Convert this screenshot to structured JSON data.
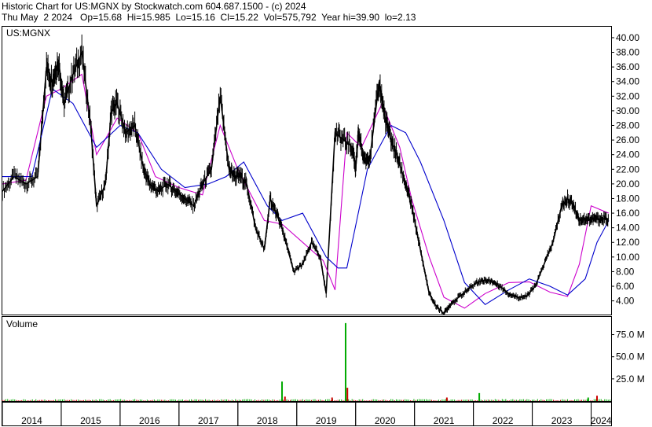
{
  "header": {
    "line1": "Historic Chart for US:MGNX by Stockwatch.com 604.687.1500 - (c) 2024",
    "line2": "Thu May  2 2024   Op=15.68  Hi=15.985  Lo=15.16  Cl=15.22  Vol=575,792  Year hi=39.90  lo=2.13"
  },
  "chart_data": {
    "type": "line",
    "title": "US:MGNX",
    "price_panel": {
      "ylim": [
        2.13,
        41.5
      ],
      "y_ticks": [
        "4.00",
        "6.00",
        "8.00",
        "10.00",
        "12.00",
        "14.00",
        "16.00",
        "18.00",
        "20.00",
        "22.00",
        "24.00",
        "26.00",
        "28.00",
        "30.00",
        "32.00",
        "34.00",
        "36.00",
        "38.00",
        "40.00"
      ],
      "series": [
        {
          "key": "price",
          "color": "#000000",
          "x": [
            2014.0,
            2014.2,
            2014.4,
            2014.6,
            2014.75,
            2014.85,
            2014.95,
            2015.05,
            2015.2,
            2015.35,
            2015.5,
            2015.6,
            2015.75,
            2015.85,
            2015.95,
            2016.1,
            2016.25,
            2016.4,
            2016.5,
            2016.65,
            2016.8,
            2016.95,
            2017.1,
            2017.25,
            2017.4,
            2017.55,
            2017.7,
            2017.85,
            2017.95,
            2018.05,
            2018.15,
            2018.3,
            2018.45,
            2018.55,
            2018.65,
            2018.75,
            2018.85,
            2018.95,
            2019.1,
            2019.25,
            2019.4,
            2019.5,
            2019.65,
            2019.8,
            2019.95,
            2020.0,
            2020.05,
            2020.15,
            2020.25,
            2020.4,
            2020.5,
            2020.6,
            2020.7,
            2020.85,
            2020.95,
            2021.05,
            2021.15,
            2021.25,
            2021.35,
            2021.5,
            2021.6,
            2021.75,
            2021.9,
            2022.05,
            2022.15,
            2022.25,
            2022.35,
            2022.45,
            2022.6,
            2022.75,
            2022.9,
            2023.05,
            2023.2,
            2023.35,
            2023.5,
            2023.6,
            2023.7,
            2023.8,
            2023.9,
            2024.0,
            2024.1,
            2024.2,
            2024.3
          ],
          "y": [
            19,
            21,
            20,
            21,
            36,
            34,
            37,
            31,
            35,
            38,
            28,
            17,
            20,
            30,
            31,
            27,
            28,
            22,
            20,
            19,
            20,
            19,
            18,
            17,
            20,
            22,
            32,
            22,
            21,
            21,
            20,
            14,
            11,
            18,
            16,
            14,
            11,
            8,
            9,
            12,
            10,
            5,
            27,
            26,
            25,
            22,
            27,
            23,
            24,
            34,
            29,
            26,
            24,
            20,
            17,
            13,
            9,
            5,
            3.5,
            2.2,
            3.5,
            4.5,
            5.5,
            6.5,
            6.8,
            6.8,
            6.5,
            6,
            5,
            4.5,
            4.6,
            6,
            9,
            12,
            17,
            18,
            17,
            15.2,
            15.2,
            15.2,
            15.2,
            15.2,
            15.2
          ]
        },
        {
          "key": "short_ma",
          "color": "#cc00cc",
          "x": [
            2014.0,
            2014.4,
            2014.75,
            2015.0,
            2015.35,
            2015.6,
            2015.95,
            2016.3,
            2016.6,
            2017.0,
            2017.4,
            2017.7,
            2018.0,
            2018.45,
            2018.75,
            2019.1,
            2019.45,
            2019.65,
            2019.85,
            2020.1,
            2020.45,
            2020.75,
            2020.95,
            2021.25,
            2021.5,
            2021.85,
            2022.2,
            2022.6,
            2022.95,
            2023.3,
            2023.6,
            2023.8,
            2024.0,
            2024.3
          ],
          "y": [
            20,
            20.5,
            32,
            33,
            35,
            24,
            29,
            27,
            21,
            19.5,
            18.5,
            28,
            22,
            15,
            14.5,
            12,
            9.5,
            5.5,
            27,
            25,
            31,
            25,
            18,
            10,
            4.5,
            3,
            5,
            6.5,
            6.6,
            5.2,
            4.6,
            9,
            17,
            16
          ]
        },
        {
          "key": "long_ma",
          "color": "#0000cc",
          "x": [
            2014.0,
            2014.5,
            2014.85,
            2015.2,
            2015.6,
            2016.0,
            2016.3,
            2016.7,
            2017.1,
            2017.5,
            2017.8,
            2018.1,
            2018.5,
            2018.75,
            2019.1,
            2019.5,
            2019.7,
            2019.85,
            2020.2,
            2020.6,
            2020.85,
            2021.1,
            2021.5,
            2021.85,
            2022.2,
            2022.6,
            2022.95,
            2023.3,
            2023.6,
            2023.9,
            2024.1,
            2024.3
          ],
          "y": [
            21,
            21,
            33,
            31,
            25,
            28,
            27,
            22,
            19.5,
            20,
            21,
            23,
            17,
            15,
            16,
            10,
            8.5,
            8.5,
            22,
            28,
            27,
            23,
            15,
            6.5,
            3.5,
            5.5,
            7,
            6,
            4.8,
            7,
            12,
            15
          ]
        }
      ]
    },
    "volume_panel": {
      "label": "Volume",
      "ylim": [
        0,
        95
      ],
      "y_ticks": [
        "25.0 M",
        "50.0 M",
        "75.0 M"
      ],
      "bars": [
        {
          "x": 2018.75,
          "v": 22,
          "color": "#00aa00"
        },
        {
          "x": 2019.83,
          "v": 88,
          "color": "#00aa00"
        },
        {
          "x": 2019.86,
          "v": 15,
          "color": "#cc0000"
        },
        {
          "x": 2019.6,
          "v": 4,
          "color": "#cc0000"
        },
        {
          "x": 2018.8,
          "v": 5,
          "color": "#cc0000"
        },
        {
          "x": 2022.1,
          "v": 9,
          "color": "#00aa00"
        },
        {
          "x": 2021.55,
          "v": 4,
          "color": "#cc0000"
        },
        {
          "x": 2024.1,
          "v": 6,
          "color": "#cc0000"
        },
        {
          "x": 2023.95,
          "v": 4,
          "color": "#00aa00"
        }
      ]
    },
    "x_ticks": [
      "2014",
      "2015",
      "2016",
      "2017",
      "2018",
      "2019",
      "2020",
      "2021",
      "2022",
      "2023",
      "2024"
    ],
    "x_tick_values": [
      2014,
      2015,
      2016,
      2017,
      2018,
      2019,
      2020,
      2021,
      2022,
      2023,
      2024
    ],
    "xlim": [
      2014.0,
      2024.34
    ]
  }
}
